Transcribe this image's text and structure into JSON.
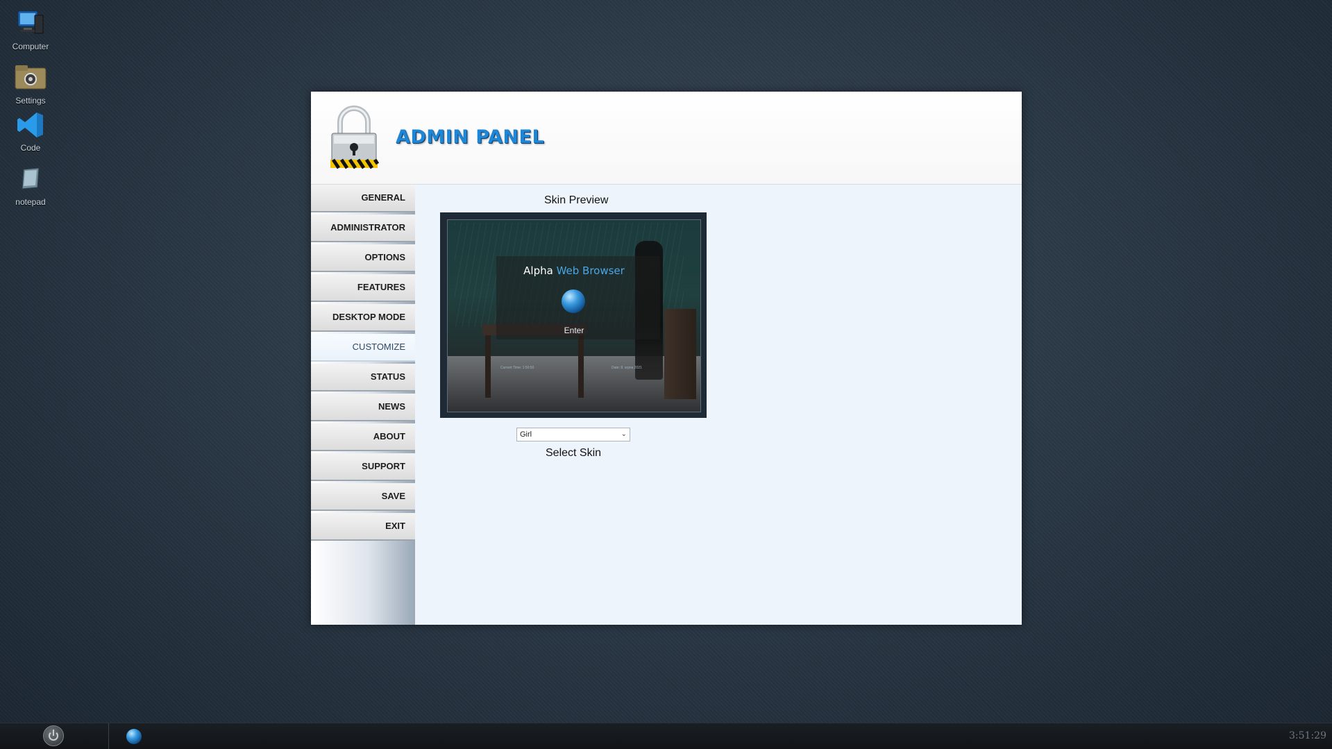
{
  "desktop": {
    "icons": [
      {
        "label": "Computer",
        "icon": "computer-icon"
      },
      {
        "label": "Settings",
        "icon": "settings-icon"
      },
      {
        "label": "Code",
        "icon": "vscode-icon"
      },
      {
        "label": "notepad",
        "icon": "notepad-icon"
      }
    ]
  },
  "window": {
    "title": "ADMIN PANEL",
    "accent_color": "#1f86d6",
    "sidebar": {
      "items": [
        {
          "label": "GENERAL"
        },
        {
          "label": "ADMINISTRATOR"
        },
        {
          "label": "OPTIONS"
        },
        {
          "label": "FEATURES"
        },
        {
          "label": "DESKTOP MODE"
        },
        {
          "label": "CUSTOMIZE",
          "active": true
        },
        {
          "label": "STATUS"
        },
        {
          "label": "NEWS"
        },
        {
          "label": "ABOUT"
        },
        {
          "label": "SUPPORT"
        },
        {
          "label": "SAVE"
        },
        {
          "label": "EXIT"
        }
      ]
    },
    "customize": {
      "preview_label": "Skin Preview",
      "preview": {
        "title_part1": "Alpha",
        "title_part2": "Web Browser",
        "enter_label": "Enter",
        "time_text": "Current Time: 1:50:50",
        "date_text": "Date: 8. srpna 2021"
      },
      "skin_select": {
        "value": "Girl"
      },
      "select_label": "Select Skin"
    }
  },
  "taskbar": {
    "clock": "3:51:29"
  }
}
